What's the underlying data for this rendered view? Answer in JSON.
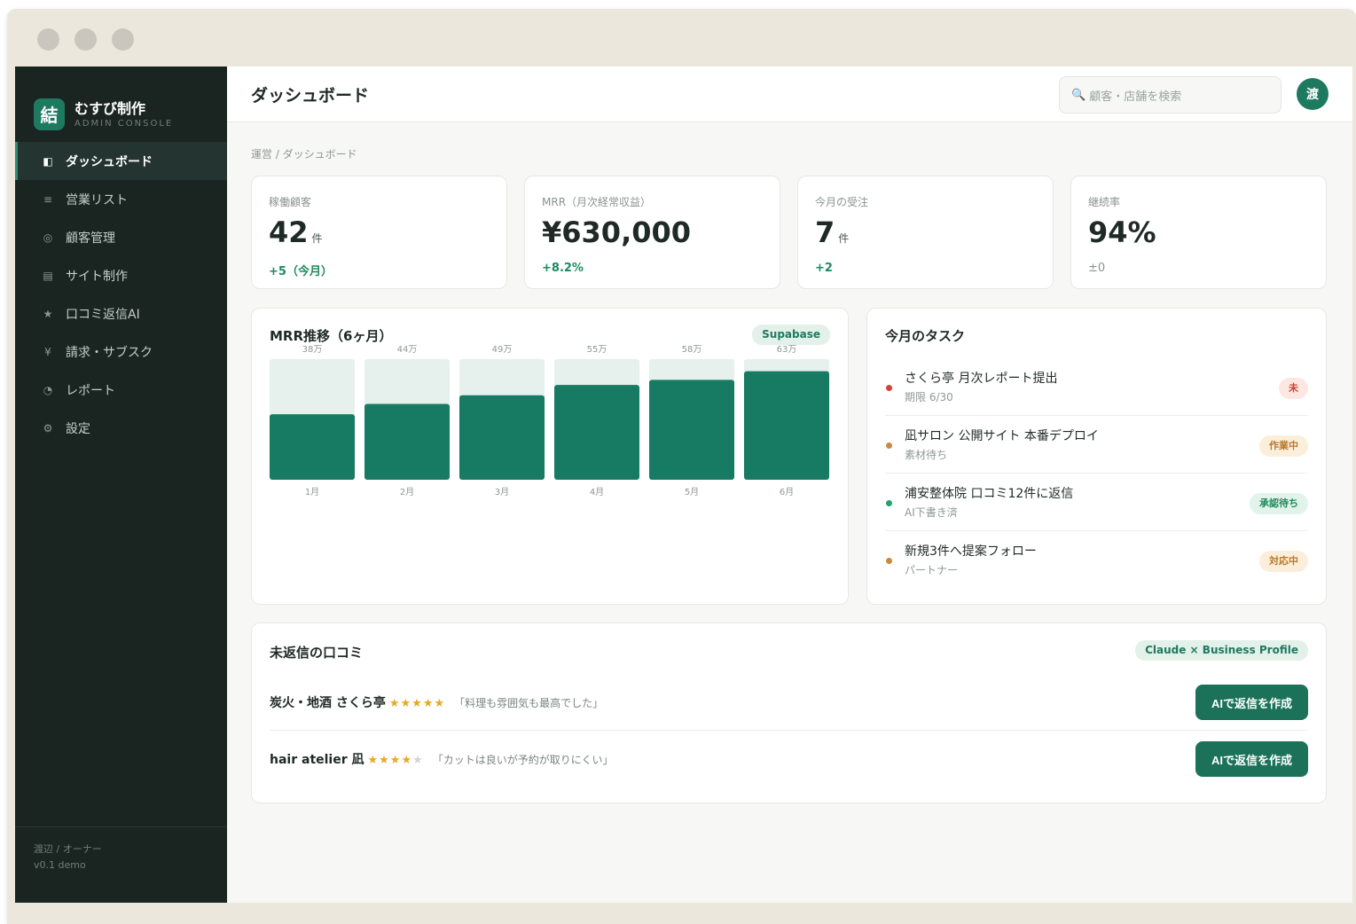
{
  "app": {
    "brand_mark": "結",
    "brand_name": "むすび制作",
    "brand_sub": "ADMIN CONSOLE"
  },
  "sidebar": {
    "items": [
      {
        "icon": "◧",
        "label": "ダッシュボード",
        "active": true
      },
      {
        "icon": "≡",
        "label": "営業リスト"
      },
      {
        "icon": "◎",
        "label": "顧客管理"
      },
      {
        "icon": "▤",
        "label": "サイト制作"
      },
      {
        "icon": "★",
        "label": "口コミ返信AI"
      },
      {
        "icon": "¥",
        "label": "請求・サブスク"
      },
      {
        "icon": "◔",
        "label": "レポート"
      },
      {
        "icon": "⚙",
        "label": "設定"
      }
    ],
    "footer_user": "渡辺 / オーナー",
    "footer_version": "v0.1 demo"
  },
  "header": {
    "title": "ダッシュボード",
    "search_placeholder": "顧客・店舗を検索",
    "avatar": "渡"
  },
  "breadcrumb": "運営 / ダッシュボード",
  "kpis": [
    {
      "label": "稼働顧客",
      "value": "42",
      "unit": "件",
      "delta": "+5（今月）",
      "tone": "up"
    },
    {
      "label": "MRR（月次経常収益）",
      "value": "¥630,000",
      "unit": "",
      "delta": "+8.2%",
      "tone": "up"
    },
    {
      "label": "今月の受注",
      "value": "7",
      "unit": "件",
      "delta": "+2",
      "tone": "up"
    },
    {
      "label": "継続率",
      "value": "94%",
      "unit": "",
      "delta": "±0",
      "tone": "neutral"
    }
  ],
  "mrr_card": {
    "title": "MRR推移（6ヶ月）",
    "badge": "Supabase"
  },
  "chart_data": {
    "type": "bar",
    "title": "MRR推移（6ヶ月）",
    "categories": [
      "1月",
      "2月",
      "3月",
      "4月",
      "5月",
      "6月"
    ],
    "values": [
      38,
      44,
      49,
      55,
      58,
      63
    ],
    "value_labels": [
      "38万",
      "44万",
      "49万",
      "55万",
      "58万",
      "63万"
    ],
    "unit": "万",
    "ylim": [
      0,
      70
    ],
    "grid": false,
    "colors": {
      "bar": "#177a62",
      "track": "#e6f0ec"
    }
  },
  "tasks_card": {
    "title": "今月のタスク",
    "items": [
      {
        "title": "さくら亭 月次レポート提出",
        "sub": "期限 6/30",
        "badge": "未",
        "dot": "#d64236",
        "badge_bg": "#fde7e3",
        "badge_fg": "#c9452f"
      },
      {
        "title": "凪サロン 公開サイト 本番デプロイ",
        "sub": "素材待ち",
        "badge": "作業中",
        "dot": "#c98a3d",
        "badge_bg": "#fbefdc",
        "badge_fg": "#b9792b"
      },
      {
        "title": "浦安整体院 口コミ12件に返信",
        "sub": "AI下書き済",
        "badge": "承認待ち",
        "dot": "#22a36b",
        "badge_bg": "#e1f3ea",
        "badge_fg": "#1f8a5c"
      },
      {
        "title": "新規3件へ提案フォロー",
        "sub": "パートナー",
        "badge": "対応中",
        "dot": "#c98a3d",
        "badge_bg": "#fbefdc",
        "badge_fg": "#b9792b"
      }
    ]
  },
  "reviews_card": {
    "title": "未返信の口コミ",
    "badge": "Claude × Business Profile",
    "items": [
      {
        "name": "炭火・地酒 さくら亭",
        "stars_on": "★★★★★",
        "stars_off": "",
        "rating": 5,
        "quote": "「料理も雰囲気も最高でした」",
        "button": "AIで返信を作成"
      },
      {
        "name": "hair atelier 凪",
        "stars_on": "★★★★",
        "stars_off": "★",
        "rating": 4,
        "quote": "「カットは良いが予約が取りにくい」",
        "button": "AIで返信を作成"
      }
    ]
  }
}
